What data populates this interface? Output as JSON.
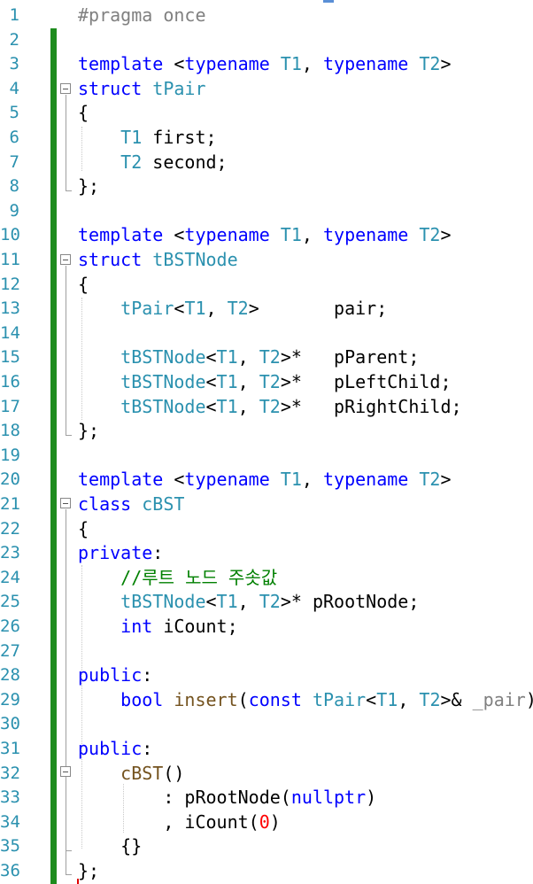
{
  "line_numbers": [
    "1",
    "2",
    "3",
    "4",
    "5",
    "6",
    "7",
    "8",
    "9",
    "10",
    "11",
    "12",
    "13",
    "14",
    "15",
    "16",
    "17",
    "18",
    "19",
    "20",
    "21",
    "22",
    "23",
    "24",
    "25",
    "26",
    "27",
    "28",
    "29",
    "30",
    "31",
    "32",
    "33",
    "34",
    "35",
    "36"
  ],
  "code": [
    [
      {
        "t": "#pragma once",
        "c": "pp"
      }
    ],
    [],
    [
      {
        "t": "template",
        "c": "kw"
      },
      {
        "t": " <",
        "c": ""
      },
      {
        "t": "typename",
        "c": "kw"
      },
      {
        "t": " ",
        "c": ""
      },
      {
        "t": "T1",
        "c": "ty"
      },
      {
        "t": ", ",
        "c": ""
      },
      {
        "t": "typename",
        "c": "kw"
      },
      {
        "t": " ",
        "c": ""
      },
      {
        "t": "T2",
        "c": "ty"
      },
      {
        "t": ">",
        "c": ""
      }
    ],
    [
      {
        "t": "struct",
        "c": "kw"
      },
      {
        "t": " ",
        "c": ""
      },
      {
        "t": "tPair",
        "c": "ty"
      }
    ],
    [
      {
        "t": "{",
        "c": ""
      }
    ],
    [
      {
        "t": "    ",
        "c": ""
      },
      {
        "t": "T1",
        "c": "ty"
      },
      {
        "t": " first;",
        "c": ""
      }
    ],
    [
      {
        "t": "    ",
        "c": ""
      },
      {
        "t": "T2",
        "c": "ty"
      },
      {
        "t": " second;",
        "c": ""
      }
    ],
    [
      {
        "t": "};",
        "c": ""
      }
    ],
    [],
    [
      {
        "t": "template",
        "c": "kw"
      },
      {
        "t": " <",
        "c": ""
      },
      {
        "t": "typename",
        "c": "kw"
      },
      {
        "t": " ",
        "c": ""
      },
      {
        "t": "T1",
        "c": "ty"
      },
      {
        "t": ", ",
        "c": ""
      },
      {
        "t": "typename",
        "c": "kw"
      },
      {
        "t": " ",
        "c": ""
      },
      {
        "t": "T2",
        "c": "ty"
      },
      {
        "t": ">",
        "c": ""
      }
    ],
    [
      {
        "t": "struct",
        "c": "kw"
      },
      {
        "t": " ",
        "c": ""
      },
      {
        "t": "tBSTNode",
        "c": "ty"
      }
    ],
    [
      {
        "t": "{",
        "c": ""
      }
    ],
    [
      {
        "t": "    ",
        "c": ""
      },
      {
        "t": "tPair",
        "c": "ty"
      },
      {
        "t": "<",
        "c": ""
      },
      {
        "t": "T1",
        "c": "ty"
      },
      {
        "t": ", ",
        "c": ""
      },
      {
        "t": "T2",
        "c": "ty"
      },
      {
        "t": ">       pair;",
        "c": ""
      }
    ],
    [],
    [
      {
        "t": "    ",
        "c": ""
      },
      {
        "t": "tBSTNode",
        "c": "ty"
      },
      {
        "t": "<",
        "c": ""
      },
      {
        "t": "T1",
        "c": "ty"
      },
      {
        "t": ", ",
        "c": ""
      },
      {
        "t": "T2",
        "c": "ty"
      },
      {
        "t": ">*   pParent;",
        "c": ""
      }
    ],
    [
      {
        "t": "    ",
        "c": ""
      },
      {
        "t": "tBSTNode",
        "c": "ty"
      },
      {
        "t": "<",
        "c": ""
      },
      {
        "t": "T1",
        "c": "ty"
      },
      {
        "t": ", ",
        "c": ""
      },
      {
        "t": "T2",
        "c": "ty"
      },
      {
        "t": ">*   pLeftChild;",
        "c": ""
      }
    ],
    [
      {
        "t": "    ",
        "c": ""
      },
      {
        "t": "tBSTNode",
        "c": "ty"
      },
      {
        "t": "<",
        "c": ""
      },
      {
        "t": "T1",
        "c": "ty"
      },
      {
        "t": ", ",
        "c": ""
      },
      {
        "t": "T2",
        "c": "ty"
      },
      {
        "t": ">*   pRightChild;",
        "c": ""
      }
    ],
    [
      {
        "t": "};",
        "c": ""
      }
    ],
    [],
    [
      {
        "t": "template",
        "c": "kw"
      },
      {
        "t": " <",
        "c": ""
      },
      {
        "t": "typename",
        "c": "kw"
      },
      {
        "t": " ",
        "c": ""
      },
      {
        "t": "T1",
        "c": "ty"
      },
      {
        "t": ", ",
        "c": ""
      },
      {
        "t": "typename",
        "c": "kw"
      },
      {
        "t": " ",
        "c": ""
      },
      {
        "t": "T2",
        "c": "ty"
      },
      {
        "t": ">",
        "c": ""
      }
    ],
    [
      {
        "t": "class",
        "c": "kw"
      },
      {
        "t": " ",
        "c": ""
      },
      {
        "t": "cBST",
        "c": "ty"
      }
    ],
    [
      {
        "t": "{",
        "c": ""
      }
    ],
    [
      {
        "t": "private",
        "c": "kw"
      },
      {
        "t": ":",
        "c": ""
      }
    ],
    [
      {
        "t": "    ",
        "c": ""
      },
      {
        "t": "//루트 노드 주솟값",
        "c": "cm"
      }
    ],
    [
      {
        "t": "    ",
        "c": ""
      },
      {
        "t": "tBSTNode",
        "c": "ty"
      },
      {
        "t": "<",
        "c": ""
      },
      {
        "t": "T1",
        "c": "ty"
      },
      {
        "t": ", ",
        "c": ""
      },
      {
        "t": "T2",
        "c": "ty"
      },
      {
        "t": ">* pRootNode;",
        "c": ""
      }
    ],
    [
      {
        "t": "    ",
        "c": ""
      },
      {
        "t": "int",
        "c": "kw"
      },
      {
        "t": " iCount;",
        "c": ""
      }
    ],
    [],
    [
      {
        "t": "public",
        "c": "kw"
      },
      {
        "t": ":",
        "c": ""
      }
    ],
    [
      {
        "t": "    ",
        "c": ""
      },
      {
        "t": "bool",
        "c": "kw"
      },
      {
        "t": " ",
        "c": ""
      },
      {
        "t": "insert",
        "c": "fn"
      },
      {
        "t": "(",
        "c": ""
      },
      {
        "t": "const",
        "c": "kw"
      },
      {
        "t": " ",
        "c": ""
      },
      {
        "t": "tPair",
        "c": "ty"
      },
      {
        "t": "<",
        "c": ""
      },
      {
        "t": "T1",
        "c": "ty"
      },
      {
        "t": ", ",
        "c": ""
      },
      {
        "t": "T2",
        "c": "ty"
      },
      {
        "t": ">& ",
        "c": ""
      },
      {
        "t": "_pair",
        "c": "pr"
      },
      {
        "t": ");",
        "c": ""
      }
    ],
    [],
    [
      {
        "t": "public",
        "c": "kw"
      },
      {
        "t": ":",
        "c": ""
      }
    ],
    [
      {
        "t": "    ",
        "c": ""
      },
      {
        "t": "cBST",
        "c": "fn"
      },
      {
        "t": "()",
        "c": ""
      }
    ],
    [
      {
        "t": "        : ",
        "c": ""
      },
      {
        "t": "pRootNode",
        "c": ""
      },
      {
        "t": "(",
        "c": ""
      },
      {
        "t": "nullptr",
        "c": "kw"
      },
      {
        "t": ")",
        "c": ""
      }
    ],
    [
      {
        "t": "        , ",
        "c": ""
      },
      {
        "t": "iCount",
        "c": ""
      },
      {
        "t": "(",
        "c": ""
      },
      {
        "t": "0",
        "c": "nm"
      },
      {
        "t": ")",
        "c": ""
      }
    ],
    [
      {
        "t": "    ",
        "c": ""
      },
      {
        "t": "{}",
        "c": ""
      }
    ],
    [
      {
        "t": "};",
        "c": ""
      }
    ]
  ],
  "colors": {
    "keyword": "#0000ff",
    "type": "#2b91af",
    "comment": "#008000",
    "preprocessor": "#808080",
    "function": "#74531f",
    "number": "#ff0000",
    "change_bar": "#1e8c1e",
    "line_number": "#2b91af"
  }
}
